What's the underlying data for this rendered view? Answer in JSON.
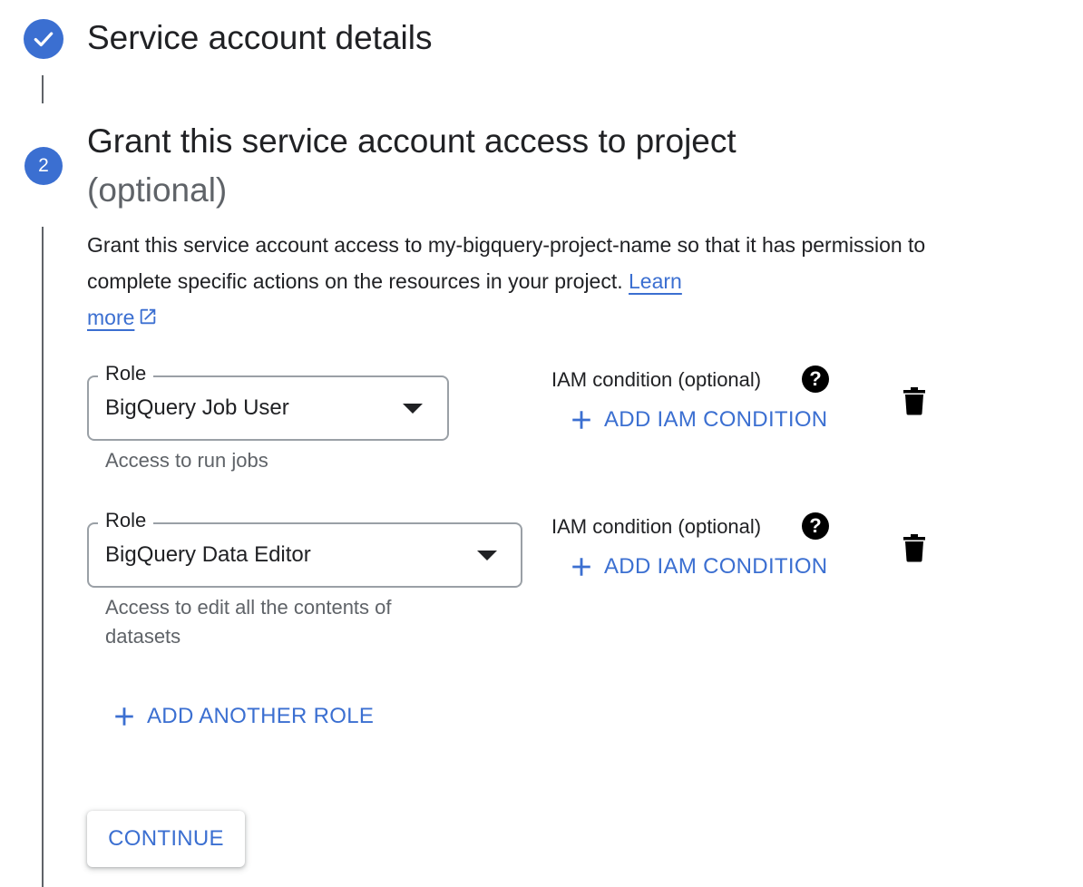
{
  "step1": {
    "title": "Service account details",
    "status_icon": "check-icon"
  },
  "step2": {
    "number": "2",
    "title": "Grant this service account access to project",
    "optional_label": "(optional)",
    "description": "Grant this service account access to my-bigquery-project-name so that it has permission to complete specific actions on the resources in your project.",
    "learn_more_first": "Learn",
    "learn_more_second": "more",
    "learn_more_icon": "open-in-new-icon"
  },
  "roles": [
    {
      "label": "Role",
      "value": "BigQuery Job User",
      "help": "Access to run jobs",
      "iam_label": "IAM condition (optional)",
      "add_iam": "ADD IAM CONDITION"
    },
    {
      "label": "Role",
      "value": "BigQuery Data Editor",
      "help": "Access to edit all the contents of datasets",
      "iam_label": "IAM condition (optional)",
      "add_iam": "ADD IAM CONDITION"
    }
  ],
  "help_icon_glyph": "?",
  "add_another_role": "ADD ANOTHER ROLE",
  "continue": "CONTINUE",
  "colors": {
    "accent": "#3b6fd1",
    "text": "#202124",
    "secondary_text": "#5f6368"
  }
}
